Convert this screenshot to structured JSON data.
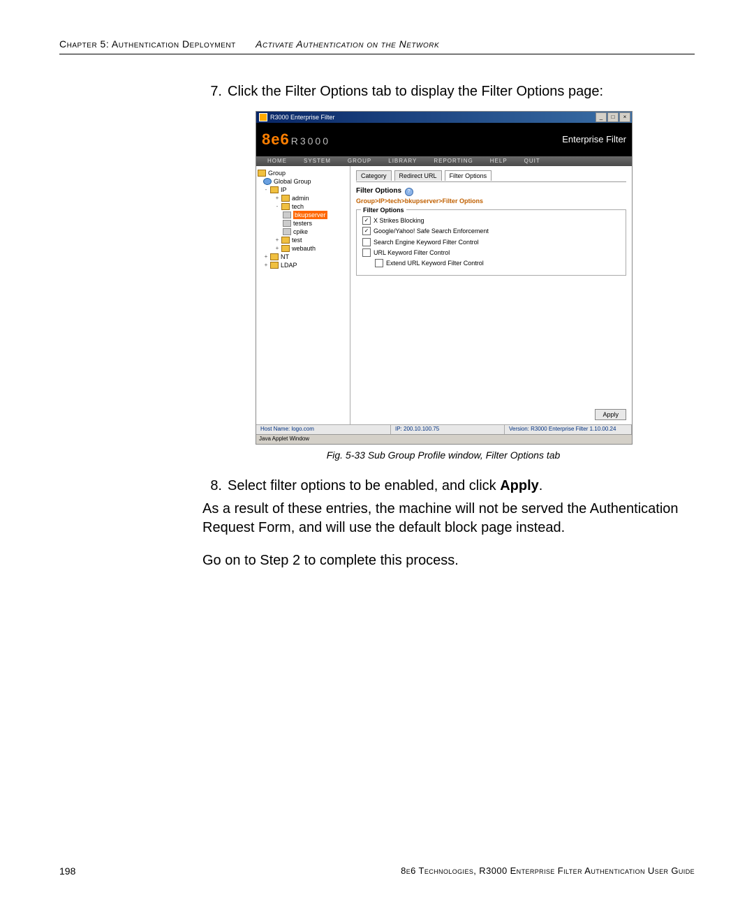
{
  "header": {
    "chapter": "Chapter 5: Authentication Deployment",
    "section": "Activate Authentication on the Network"
  },
  "step7": {
    "num": "7.",
    "text": "Click the Filter Options tab to display the Filter Options page:"
  },
  "caption": "Fig. 5-33  Sub Group Profile window, Filter Options tab",
  "step8": {
    "num": "8.",
    "prefix": "Select filter options to be enabled, and click ",
    "bold": "Apply",
    "suffix": "."
  },
  "para1": "As a result of these entries, the machine will not be served the Authentication Request Form, and will use the default block page instead.",
  "para2": "Go on to Step 2 to complete this process.",
  "footer": {
    "page": "198",
    "guide": "8e6 Technologies, R3000 Enterprise Filter Authentication User Guide"
  },
  "app": {
    "title": "R3000 Enterprise Filter",
    "winbtns": {
      "min": "_",
      "max": "□",
      "close": "×"
    },
    "brand": {
      "logo1": "8e6",
      "logo2": "R3000",
      "product": "Enterprise Filter"
    },
    "menu": [
      "HOME",
      "SYSTEM",
      "GROUP",
      "LIBRARY",
      "REPORTING",
      "HELP",
      "QUIT"
    ],
    "tree": {
      "root": "Group",
      "items": [
        {
          "label": "Global Group",
          "indent": 1,
          "icon": "globe"
        },
        {
          "label": "IP",
          "indent": 1,
          "toggle": "-",
          "icon": "folder"
        },
        {
          "label": "admin",
          "indent": 3,
          "toggle": "+",
          "icon": "folder"
        },
        {
          "label": "tech",
          "indent": 3,
          "toggle": "-",
          "icon": "folder"
        },
        {
          "label": "bkupserver",
          "indent": 4,
          "icon": "pc",
          "selected": true
        },
        {
          "label": "testers",
          "indent": 4,
          "icon": "pc"
        },
        {
          "label": "cpike",
          "indent": 4,
          "icon": "pc"
        },
        {
          "label": "test",
          "indent": 3,
          "toggle": "+",
          "icon": "folder"
        },
        {
          "label": "webauth",
          "indent": 3,
          "toggle": "+",
          "icon": "folder"
        },
        {
          "label": "NT",
          "indent": 1,
          "toggle": "+",
          "icon": "folder"
        },
        {
          "label": "LDAP",
          "indent": 1,
          "toggle": "+",
          "icon": "folder"
        }
      ]
    },
    "tabs": {
      "items": [
        "Category",
        "Redirect URL",
        "Filter Options"
      ],
      "active": 2
    },
    "panel": {
      "heading": "Filter Options",
      "help": "?",
      "crumb": "Group>IP>tech>bkupserver>Filter Options",
      "legend": "Filter Options",
      "checks": [
        {
          "label": "X Strikes Blocking",
          "checked": true,
          "indent": false
        },
        {
          "label": "Google/Yahoo! Safe Search Enforcement",
          "checked": true,
          "indent": false
        },
        {
          "label": "Search Engine Keyword Filter Control",
          "checked": false,
          "indent": false
        },
        {
          "label": "URL Keyword Filter Control",
          "checked": false,
          "indent": false
        },
        {
          "label": "Extend URL Keyword Filter Control",
          "checked": false,
          "indent": true
        }
      ],
      "apply": "Apply"
    },
    "status": {
      "host": "Host Name: logo.com",
      "ip": "IP: 200.10.100.75",
      "version": "Version: R3000 Enterprise Filter 1.10.00.24"
    },
    "applet": "Java Applet Window"
  }
}
